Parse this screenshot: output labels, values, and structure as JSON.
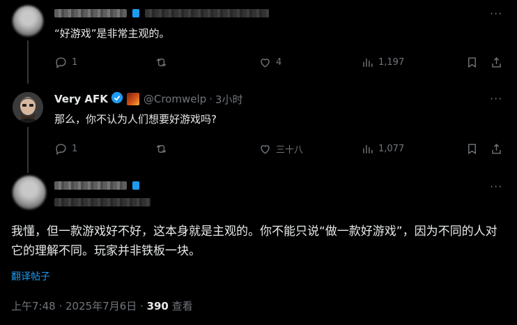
{
  "tweet1": {
    "text": "“好游戏”是非常主观的。",
    "more": "···",
    "actions": {
      "reply": "1",
      "retweet": "",
      "like": "4",
      "views": "1,197"
    }
  },
  "tweet2": {
    "name": "Very AFK",
    "handle": "@Cromwelp",
    "separator": "·",
    "time": "3小时",
    "more": "···",
    "text": "那么，你不认为人们想要好游戏吗?",
    "actions": {
      "reply": "1",
      "retweet": "",
      "like": "三十八",
      "views": "1,077"
    }
  },
  "main": {
    "more": "···",
    "text": "我懂，但一款游戏好不好，这本身就是主观的。你不能只说“做一款好游戏”，因为不同的人对它的理解不同。玩家并非铁板一块。",
    "translate": "翻译帖子",
    "timestamp": "上午7:48 · 2025年7月6日 · ",
    "views_count": "390",
    "views_label": " 查看"
  },
  "colors": {
    "accent": "#1d9bf0",
    "muted": "#71767b",
    "text": "#e7e9ea",
    "bg": "#000000"
  }
}
